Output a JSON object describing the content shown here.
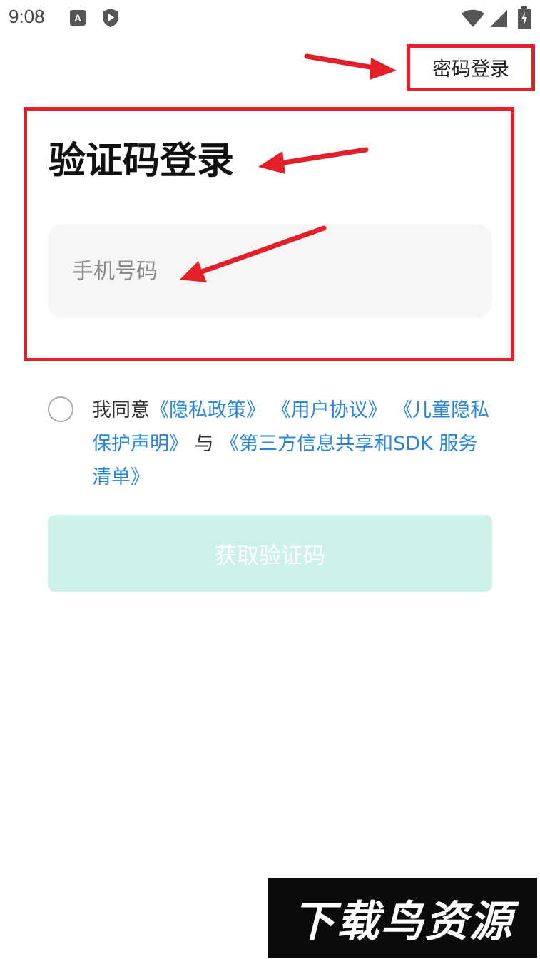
{
  "status_bar": {
    "time": "9:08",
    "notification_icons": [
      "font-a-icon",
      "shield-play-icon"
    ],
    "system_icons": [
      "wifi-icon",
      "signal-icon",
      "battery-charging-icon"
    ]
  },
  "header": {
    "password_login_label": "密码登录"
  },
  "main": {
    "title": "验证码登录",
    "phone_input": {
      "value": "",
      "placeholder": "手机号码"
    }
  },
  "agreement": {
    "checked": false,
    "prefix": "我同意",
    "privacy_policy": "《隐私政策》",
    "user_agreement": "《用户协议》",
    "children_privacy": "《儿童隐私保护声明》",
    "conjunction": "与",
    "third_party_list": "《第三方信息共享和SDK 服务清单》"
  },
  "submit": {
    "label": "获取验证码"
  },
  "watermark": {
    "text": "下载鸟资源"
  },
  "colors": {
    "link": "#2b86d6",
    "button_disabled_bg": "#ccf0ea",
    "annotation_red": "#e3202a",
    "input_bg": "#f6f6f6"
  }
}
